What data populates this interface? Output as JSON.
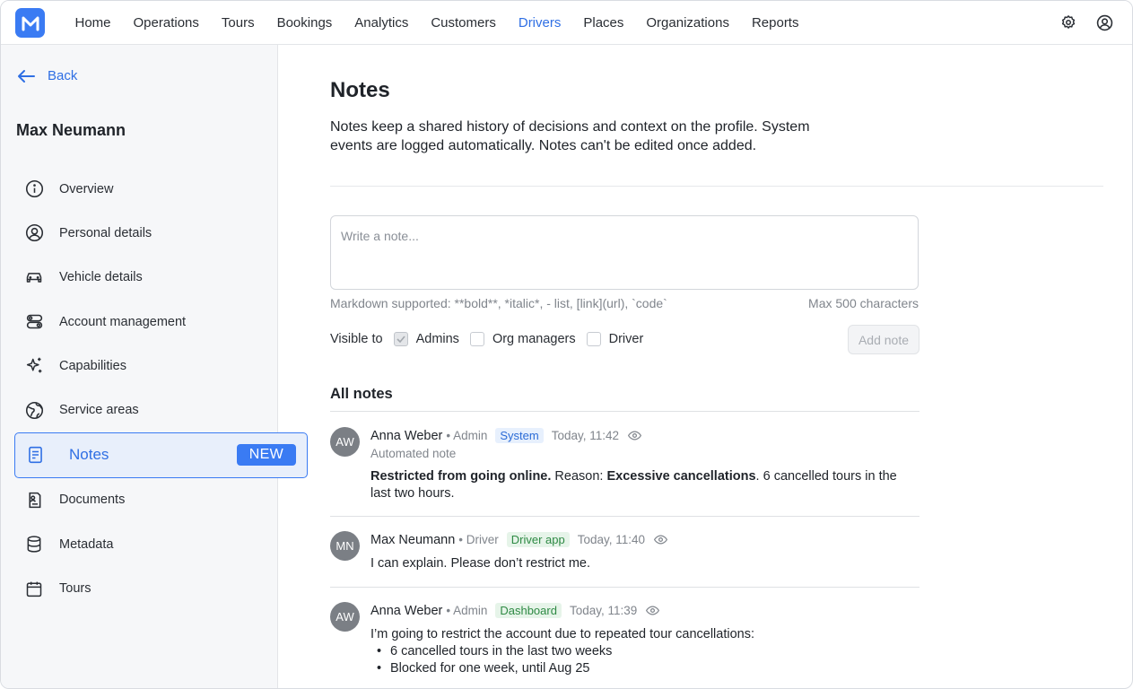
{
  "topbar": {
    "nav": [
      "Home",
      "Operations",
      "Tours",
      "Bookings",
      "Analytics",
      "Customers",
      "Drivers",
      "Places",
      "Organizations",
      "Reports"
    ],
    "active_nav": "Drivers"
  },
  "sidebar": {
    "back_label": "Back",
    "profile_name": "Max Neumann",
    "items": [
      {
        "label": "Overview",
        "icon": "info-icon"
      },
      {
        "label": "Personal details",
        "icon": "user-circle-icon"
      },
      {
        "label": "Vehicle details",
        "icon": "car-icon"
      },
      {
        "label": "Account management",
        "icon": "toggles-icon"
      },
      {
        "label": "Capabilities",
        "icon": "sparkles-icon"
      },
      {
        "label": "Service areas",
        "icon": "globe-icon"
      },
      {
        "label": "Notes",
        "icon": "document-icon",
        "badge": "NEW",
        "active": true
      },
      {
        "label": "Documents",
        "icon": "id-document-icon"
      },
      {
        "label": "Metadata",
        "icon": "database-icon"
      },
      {
        "label": "Tours",
        "icon": "calendar-icon"
      }
    ]
  },
  "main": {
    "title": "Notes",
    "description": "Notes keep a shared history of decisions and context on the profile. System events are logged automatically. Notes can't be edited once added.",
    "input_placeholder": "Write a note...",
    "hint": "Markdown supported: **bold**, *italic*, - list, [link](url), `code`",
    "max_chars": "Max 500 characters",
    "visible_to_label": "Visible to",
    "visibility": [
      {
        "label": "Admins",
        "checked": true
      },
      {
        "label": "Org managers",
        "checked": false
      },
      {
        "label": "Driver",
        "checked": false
      }
    ],
    "add_button": "Add note",
    "all_notes_title": "All notes",
    "notes": [
      {
        "initials": "AW",
        "author": "Anna Weber",
        "role": "• Admin",
        "source": "System",
        "time": "Today, 11:42",
        "sub": "Automated note",
        "body_parts": [
          "Restricted from going online.",
          " Reason: ",
          "Excessive cancellations",
          ". 6 cancelled tours in the last two hours."
        ]
      },
      {
        "initials": "MN",
        "author": "Max Neumann",
        "role": "• Driver",
        "source": "Driver app",
        "time": "Today, 11:40",
        "body": "I can explain. Please don’t restrict me."
      },
      {
        "initials": "AW",
        "author": "Anna Weber",
        "role": "• Admin",
        "source": "Dashboard",
        "time": "Today, 11:39",
        "body": "I’m going to restrict the account due to repeated tour cancellations:",
        "bullets": [
          "6 cancelled tours in the last two weeks",
          "Blocked for one week, until Aug 25"
        ]
      }
    ]
  },
  "colors": {
    "accent": "#3a7bf3",
    "system_tag": "#2b6bd6",
    "green_tag": "#2e8a44"
  }
}
